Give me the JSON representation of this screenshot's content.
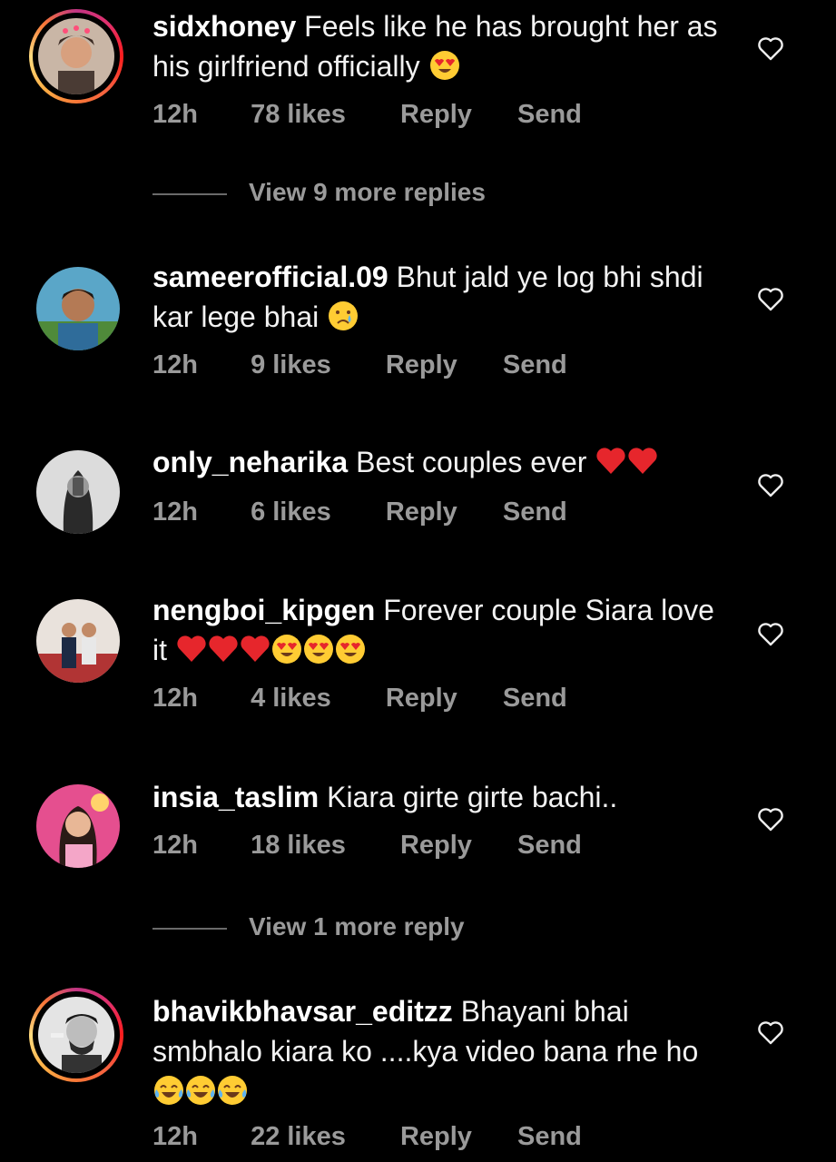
{
  "comments": [
    {
      "username": "sidxhoney",
      "text": "Feels like he has brought her as his girlfriend officially",
      "emojis": [
        "heart-eyes"
      ],
      "time": "12h",
      "likes": "78 likes",
      "reply": "Reply",
      "send": "Send",
      "has_story_ring": true
    },
    {
      "username": "sameerofficial.09",
      "text": "Bhut jald ye log bhi shdi kar lege bhai",
      "emojis": [
        "crying"
      ],
      "time": "12h",
      "likes": "9 likes",
      "reply": "Reply",
      "send": "Send",
      "has_story_ring": false
    },
    {
      "username": "only_neharika",
      "text": "Best couples  ever",
      "emojis": [
        "red-heart",
        "red-heart"
      ],
      "time": "12h",
      "likes": "6 likes",
      "reply": "Reply",
      "send": "Send",
      "has_story_ring": false
    },
    {
      "username": "nengboi_kipgen",
      "text": "Forever couple Siara love it",
      "emojis": [
        "red-heart",
        "red-heart",
        "red-heart",
        "heart-eyes",
        "heart-eyes",
        "heart-eyes"
      ],
      "time": "12h",
      "likes": "4 likes",
      "reply": "Reply",
      "send": "Send",
      "has_story_ring": false
    },
    {
      "username": "insia_taslim",
      "text": "Kiara girte girte bachi..",
      "emojis": [],
      "time": "12h",
      "likes": "18 likes",
      "reply": "Reply",
      "send": "Send",
      "has_story_ring": false
    },
    {
      "username": "bhavikbhavsar_editzz",
      "text": "Bhayani bhai smbhalo kiara ko ....kya video bana rhe ho",
      "emojis": [
        "tears-of-joy",
        "tears-of-joy",
        "tears-of-joy"
      ],
      "time": "12h",
      "likes": "22 likes",
      "reply": "Reply",
      "send": "Send",
      "has_story_ring": true
    }
  ],
  "view_more": [
    "View 9 more replies",
    "View 1 more reply"
  ],
  "colors": {
    "background": "#000000",
    "text": "#f2f2f2",
    "meta": "#9a9a9a",
    "heart_emoji": "#e6262c",
    "face_emoji": "#ffcc33"
  },
  "icons": {
    "like": "heart-outline-icon"
  }
}
